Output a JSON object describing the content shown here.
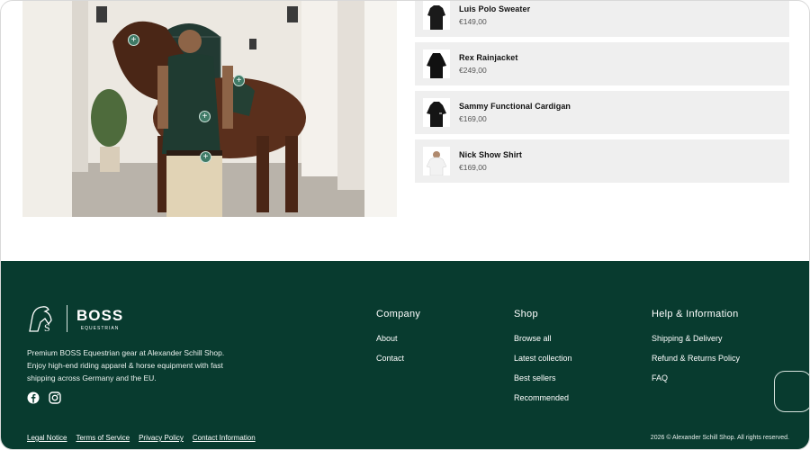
{
  "products": [
    {
      "name": "Luis Polo Sweater",
      "price": "€149,00",
      "thumb": "dark-sweater"
    },
    {
      "name": "Rex Rainjacket",
      "price": "€249,00",
      "thumb": "dark-jacket"
    },
    {
      "name": "Sammy Functional Cardigan",
      "price": "€169,00",
      "thumb": "dark-cardigan"
    },
    {
      "name": "Nick Show Shirt",
      "price": "€169,00",
      "thumb": "white-shirt"
    }
  ],
  "hotspots": {
    "symbol": "+"
  },
  "footer": {
    "brand": {
      "name": "BOSS",
      "tagline": "EQUESTRIAN"
    },
    "blurb": "Premium BOSS Equestrian gear at Alexander Schill Shop. Enjoy high-end riding apparel & horse equipment with fast shipping across Germany and the EU.",
    "social": [
      "facebook-icon",
      "instagram-icon"
    ],
    "company": {
      "heading": "Company",
      "links": [
        "About",
        "Contact"
      ]
    },
    "shop": {
      "heading": "Shop",
      "links": [
        "Browse all",
        "Latest collection",
        "Best sellers",
        "Recommended"
      ]
    },
    "help": {
      "heading": "Help & Information",
      "links": [
        "Shipping & Delivery",
        "Refund & Returns Policy",
        "FAQ"
      ]
    },
    "legal": [
      "Legal Notice",
      "Terms of Service",
      "Privacy Policy",
      "Contact Information"
    ],
    "copyright": "2026 © Alexander Schill Shop. All rights reserved."
  },
  "colors": {
    "footer_bg": "#083b2f",
    "hotspot": "#3f7a66",
    "card_bg": "#efefef"
  }
}
